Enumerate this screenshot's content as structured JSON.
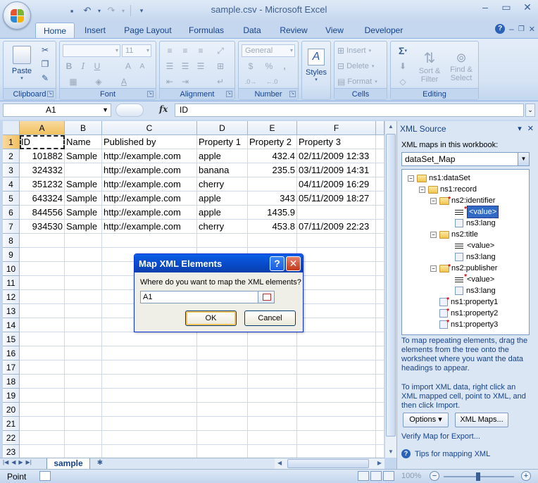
{
  "window": {
    "title": "sample.csv - Microsoft Excel"
  },
  "tabs": [
    {
      "label": "Home",
      "active": true
    },
    {
      "label": "Insert"
    },
    {
      "label": "Page Layout"
    },
    {
      "label": "Formulas"
    },
    {
      "label": "Data"
    },
    {
      "label": "Review"
    },
    {
      "label": "View"
    },
    {
      "label": "Developer"
    }
  ],
  "ribbon": {
    "clipboard": {
      "label": "Clipboard",
      "paste": "Paste"
    },
    "font": {
      "label": "Font",
      "size": "11",
      "bold": "B",
      "italic": "I",
      "underline": "U"
    },
    "alignment": {
      "label": "Alignment"
    },
    "number": {
      "label": "Number",
      "format": "General",
      "percent": "%",
      "comma": ","
    },
    "styles": {
      "label": "Styles",
      "letter": "A"
    },
    "cells": {
      "label": "Cells",
      "insert": "Insert",
      "delete": "Delete",
      "format": "Format"
    },
    "editing": {
      "label": "Editing",
      "sigma": "Σ",
      "sort_line1": "Sort &",
      "sort_line2": "Filter",
      "find_line1": "Find &",
      "find_line2": "Select"
    }
  },
  "formula_bar": {
    "name_box": "A1",
    "fx": "fx",
    "value": "ID"
  },
  "sheet": {
    "columns": [
      "A",
      "B",
      "C",
      "D",
      "E",
      "F"
    ],
    "row_numbers": [
      "1",
      "2",
      "3",
      "4",
      "5",
      "6",
      "7",
      "8",
      "9",
      "10",
      "11",
      "12",
      "13",
      "14",
      "15",
      "16",
      "17",
      "18",
      "19",
      "20",
      "21",
      "22",
      "23"
    ],
    "rows": [
      [
        "ID",
        "Name",
        "Published by",
        "Property 1",
        "Property 2",
        "Property 3"
      ],
      [
        "101882",
        "Sample",
        "http://example.com",
        "apple",
        "432.4",
        "02/11/2009 12:33"
      ],
      [
        "324332",
        "",
        "http://example.com",
        "banana",
        "235.5",
        "03/11/2009 14:31"
      ],
      [
        "351232",
        "Sample",
        "http://example.com",
        "cherry",
        "",
        "04/11/2009 16:29"
      ],
      [
        "643324",
        "Sample",
        "http://example.com",
        "apple",
        "343",
        "05/11/2009 18:27"
      ],
      [
        "844556",
        "Sample",
        "http://example.com",
        "apple",
        "1435.9",
        ""
      ],
      [
        "934530",
        "Sample",
        "http://example.com",
        "cherry",
        "453.8",
        "07/11/2009 22:23"
      ]
    ],
    "tab_name": "sample"
  },
  "status": {
    "mode": "Point",
    "zoom": "100%",
    "minus": "−",
    "plus": "+"
  },
  "xml_pane": {
    "title": "XML Source",
    "caption": "XML maps in this workbook:",
    "map_name": "dataSet_Map",
    "tree": [
      {
        "label": "ns1:dataSet",
        "kind": "folder",
        "level": 0,
        "exp": "−"
      },
      {
        "label": "ns1:record",
        "kind": "folder",
        "level": 1,
        "exp": "−"
      },
      {
        "label": "ns2:identifier",
        "kind": "folder-req",
        "level": 2,
        "exp": "−"
      },
      {
        "label": "<value>",
        "kind": "lines-req",
        "level": 3,
        "selected": true
      },
      {
        "label": "ns3:lang",
        "kind": "leaf",
        "level": 3
      },
      {
        "label": "ns2:title",
        "kind": "folder",
        "level": 2,
        "exp": "−"
      },
      {
        "label": "<value>",
        "kind": "lines",
        "level": 3
      },
      {
        "label": "ns3:lang",
        "kind": "leaf",
        "level": 3
      },
      {
        "label": "ns2:publisher",
        "kind": "folder-req",
        "level": 2,
        "exp": "−"
      },
      {
        "label": "<value>",
        "kind": "lines-req",
        "level": 3
      },
      {
        "label": "ns3:lang",
        "kind": "leaf",
        "level": 3
      },
      {
        "label": "ns1:property1",
        "kind": "leaf-req",
        "level": 2
      },
      {
        "label": "ns1:property2",
        "kind": "leaf-req",
        "level": 2
      },
      {
        "label": "ns1:property3",
        "kind": "leaf-req",
        "level": 2
      }
    ],
    "hint1": "To map repeating elements, drag the elements from the tree onto the worksheet where you want the data headings to appear.",
    "hint2": "To import XML data, right click an XML mapped cell, point to XML, and then click Import.",
    "options_button": "Options ▾",
    "xml_maps_button": "XML Maps...",
    "verify_link": "Verify Map for Export...",
    "tips_link": "Tips for mapping XML"
  },
  "dialog": {
    "title": "Map XML Elements",
    "help": "?",
    "close": "✕",
    "prompt": "Where do you want to map the XML elements?",
    "value": "A1",
    "ok": "OK",
    "cancel": "Cancel"
  }
}
